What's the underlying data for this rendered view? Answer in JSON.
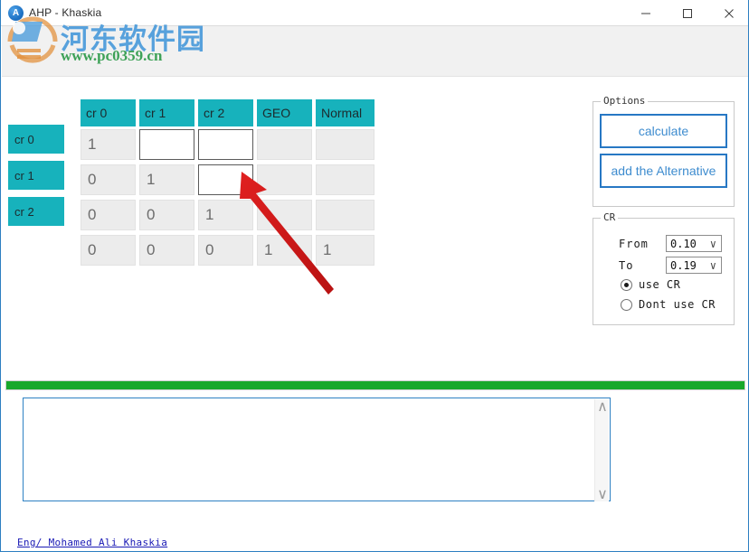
{
  "window": {
    "title": "AHP - Khaskia",
    "icon": "app-icon",
    "minimize_label": "—",
    "maximize_label": "□",
    "close_label": "✕"
  },
  "watermark": {
    "chinese": "河东软件园",
    "url": "www.pc0359.cn"
  },
  "matrix": {
    "column_headers": [
      "cr 0",
      "cr 1",
      "cr 2",
      "GEO",
      "Normal"
    ],
    "row_labels": [
      "cr 0",
      "cr 1",
      "cr 2"
    ],
    "rows": [
      {
        "cells": [
          {
            "value": "1",
            "editable": false
          },
          {
            "value": "",
            "editable": true
          },
          {
            "value": "",
            "editable": true
          },
          {
            "value": "",
            "editable": false
          },
          {
            "value": "",
            "editable": false
          }
        ]
      },
      {
        "cells": [
          {
            "value": "0",
            "editable": false
          },
          {
            "value": "1",
            "editable": false
          },
          {
            "value": "",
            "editable": true
          },
          {
            "value": "",
            "editable": false
          },
          {
            "value": "",
            "editable": false
          }
        ]
      },
      {
        "cells": [
          {
            "value": "0",
            "editable": false
          },
          {
            "value": "0",
            "editable": false
          },
          {
            "value": "1",
            "editable": false
          },
          {
            "value": "",
            "editable": false
          },
          {
            "value": "",
            "editable": false
          }
        ]
      },
      {
        "cells": [
          {
            "value": "0",
            "editable": false
          },
          {
            "value": "0",
            "editable": false
          },
          {
            "value": "0",
            "editable": false
          },
          {
            "value": "1",
            "editable": false
          },
          {
            "value": "1",
            "editable": false
          }
        ]
      }
    ]
  },
  "options": {
    "group_title": "Options",
    "calculate_label": "calculate",
    "add_alternative_label": "add the Alternative"
  },
  "cr": {
    "group_title": "CR",
    "from_label": "From",
    "from_value": "0.10",
    "to_label": "To",
    "to_value": "0.19",
    "use_cr_label": "use CR",
    "dont_use_cr_label": "Dont use CR",
    "selected": "use CR",
    "chevron": "∨"
  },
  "progress": {
    "percent": 100
  },
  "output": {
    "value": "",
    "scroll_up": "∧",
    "scroll_down": "∨"
  },
  "footer": {
    "credit": "Eng/ Mohamed Ali Khaskia"
  },
  "colors": {
    "teal_header": "#17b2bc",
    "button_border": "#2778c4",
    "button_text": "#3e8ccf",
    "progress_green": "#18a82b",
    "link_blue": "#1a1ab5",
    "annotation_red": "#d81e1e"
  }
}
